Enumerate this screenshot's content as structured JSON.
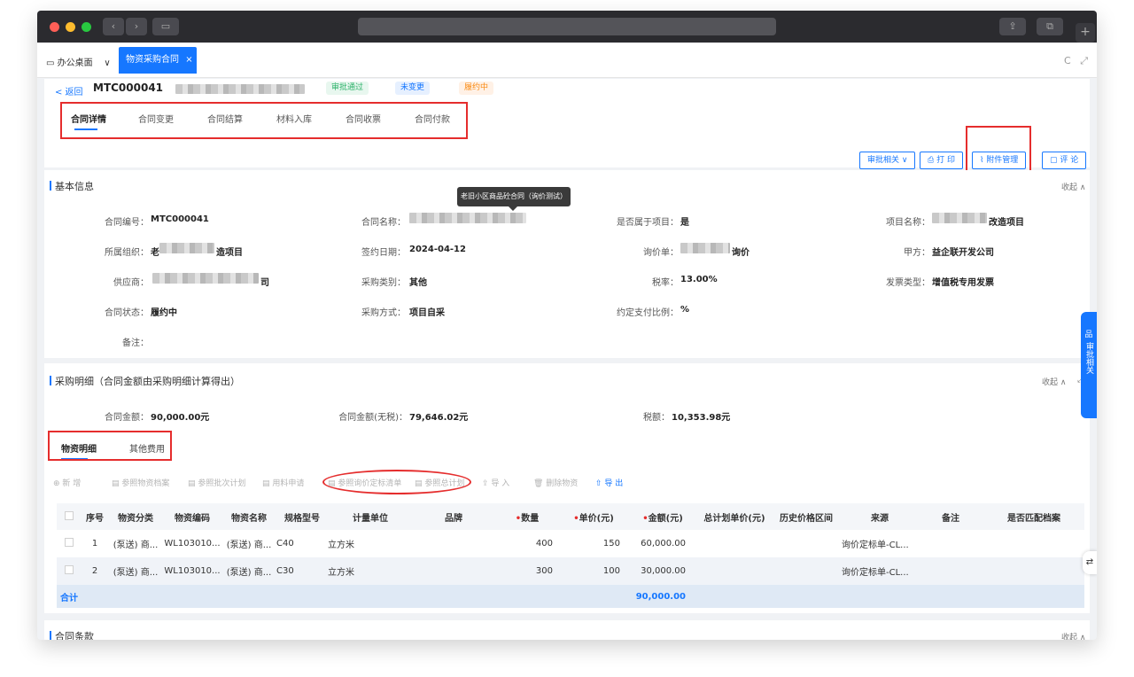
{
  "colors": {
    "accent": "#1677ff",
    "annotation_red": "#e52d2d",
    "success_green": "#52c41a",
    "warning_orange": "#fa8c16"
  },
  "browser": {
    "back_glyph": "‹",
    "forward_glyph": "›",
    "sidebar_glyph": "▭",
    "share_glyph": "⇪",
    "tabs_glyph": "⧉",
    "new_tab_glyph": "+"
  },
  "tabs": {
    "home": "办公桌面",
    "home_caret": "∨",
    "active": "物资采购合同",
    "close": "×",
    "refresh": "C",
    "fullscreen": "⤢"
  },
  "header": {
    "back": "< 返回",
    "contract_code": "MTC000041",
    "badges": {
      "approval": "审批通过",
      "change": "未变更",
      "status": "履约中"
    },
    "nav_tabs": [
      "合同详情",
      "合同变更",
      "合同结算",
      "材料入库",
      "合同收票",
      "合同付款"
    ],
    "actions": {
      "approval": "审批相关 ∨",
      "print": "打 印",
      "attachment": "附件管理",
      "comment": "评 论"
    }
  },
  "tooltip": "老旧小区商品砼合同（询价测试）",
  "basic_info": {
    "title": "基本信息",
    "collapse": "收起 ∧",
    "fields": {
      "contract_no_label": "合同编号：",
      "contract_no": "MTC000041",
      "contract_name_label": "合同名称：",
      "belongs_project_label": "是否属于项目：",
      "belongs_project": "是",
      "project_name_label": "项目名称：",
      "project_name_suffix": "改造项目",
      "org_label": "所属组织：",
      "org_prefix": "老",
      "org_suffix": "造项目",
      "sign_date_label": "签约日期：",
      "sign_date": "2024-04-12",
      "inquiry_label": "询价单：",
      "inquiry_suffix": "询价",
      "party_a_label": "甲方：",
      "party_a": "益企联开发公司",
      "supplier_label": "供应商：",
      "supplier_suffix": "司",
      "purchase_type_label": "采购类别：",
      "purchase_type": "其他",
      "tax_rate_label": "税率：",
      "tax_rate": "13.00%",
      "invoice_type_label": "发票类型：",
      "invoice_type": "增值税专用发票",
      "contract_status_label": "合同状态：",
      "contract_status": "履约中",
      "purchase_method_label": "采购方式：",
      "purchase_method": "项目自采",
      "pay_ratio_label": "约定支付比例：",
      "pay_ratio": "%",
      "remark_label": "备注："
    }
  },
  "purchase_detail": {
    "title": "采购明细（合同金额由采购明细计算得出）",
    "collapse": "收起 ∧",
    "expand": "⤢",
    "amount_label": "合同金额：",
    "amount": "90,000.00元",
    "amount_notax_label": "合同金额(无税)：",
    "amount_notax": "79,646.02元",
    "tax_label": "税额：",
    "tax": "10,353.98元",
    "subtabs": [
      "物资明细",
      "其他费用"
    ],
    "toolbar": [
      "⊕ 新 增",
      "▤ 参照物资档案",
      "▤ 参照批次计划",
      "▤ 用料申请",
      "▤ 参照询价定标清单",
      "▤ 参照总计划",
      "⇪ 导 入",
      "🗑 删除物资",
      "⇧ 导 出"
    ],
    "columns": [
      "序号",
      "物资分类",
      "物资编码",
      "物资名称",
      "规格型号",
      "计量单位",
      "品牌",
      "数量",
      "单价(元)",
      "金额(元)",
      "总计划单价(元)",
      "历史价格区间",
      "来源",
      "备注",
      "是否匹配档案"
    ],
    "rows": [
      {
        "no": "1",
        "category": "(泵送) 商...",
        "code": "WL103010...",
        "name": "(泵送) 商...",
        "spec": "C40",
        "unit": "立方米",
        "brand": "",
        "qty": "400",
        "price": "150",
        "amount": "60,000.00",
        "plan_price": "",
        "history": "",
        "source": "询价定标单-CL...",
        "remark": "",
        "matched": ""
      },
      {
        "no": "2",
        "category": "(泵送) 商...",
        "code": "WL103010...",
        "name": "(泵送) 商...",
        "spec": "C30",
        "unit": "立方米",
        "brand": "",
        "qty": "300",
        "price": "100",
        "amount": "30,000.00",
        "plan_price": "",
        "history": "",
        "source": "询价定标单-CL...",
        "remark": "",
        "matched": ""
      }
    ],
    "total_label": "合计",
    "total_amount": "90,000.00"
  },
  "contract_terms": {
    "title": "合同条款",
    "collapse": "收起 ∧"
  },
  "side_panel": {
    "icon": "品",
    "label": "审批相关"
  },
  "float_icon": "⇄"
}
